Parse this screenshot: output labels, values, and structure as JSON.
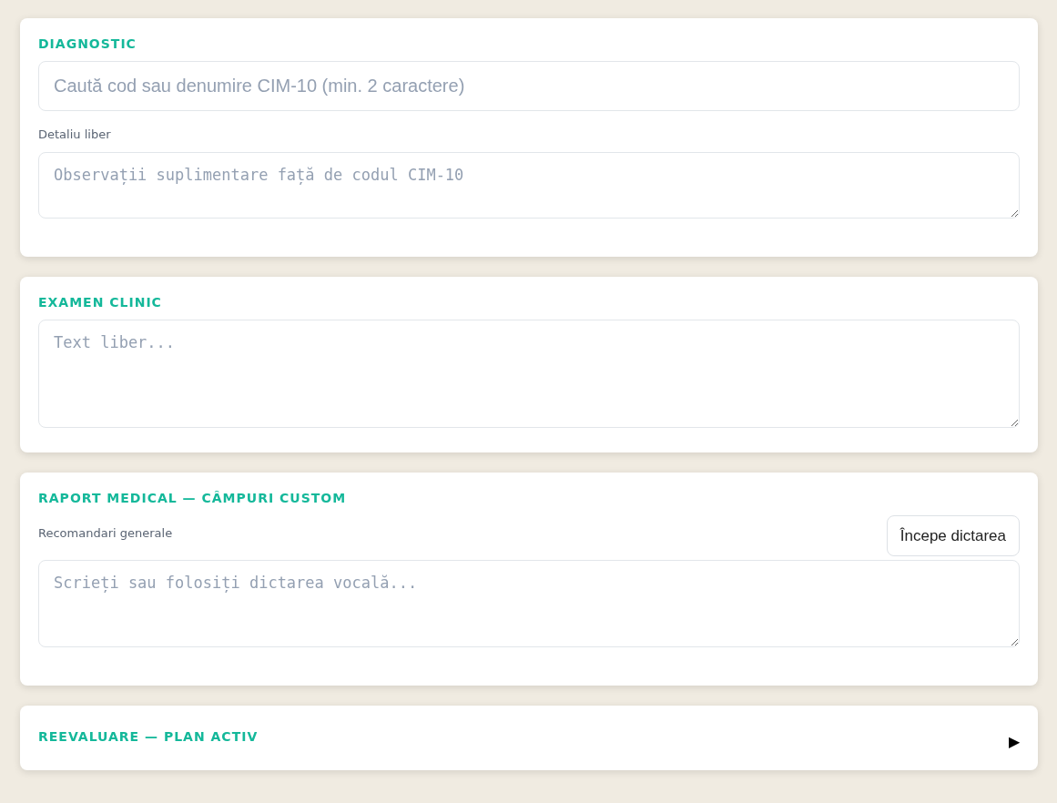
{
  "sections": [
    {
      "title": "DIAGNOSTIC",
      "fields": [
        {
          "kind": "input",
          "placeholder": "Caută cod sau denumire CIM-10 (min. 2 caractere)"
        },
        {
          "kind": "note",
          "label": "Detaliu liber",
          "placeholder": "Observații suplimentare față de codul CIM-10"
        }
      ]
    },
    {
      "title": "EXAMEN CLINIC",
      "fields": [
        {
          "kind": "textbox",
          "placeholder": "Text liber..."
        }
      ]
    },
    {
      "title": "RAPORT MEDICAL — CÂMPURI CUSTOM",
      "fields": [
        {
          "kind": "dictation",
          "label": "Recomandari generale",
          "button": "Începe dictarea",
          "placeholder": "Scrieți sau folosiți dictarea vocală..."
        }
      ]
    },
    {
      "title": "REEVALUARE — PLAN ACTIV",
      "toggle": "▶"
    }
  ]
}
